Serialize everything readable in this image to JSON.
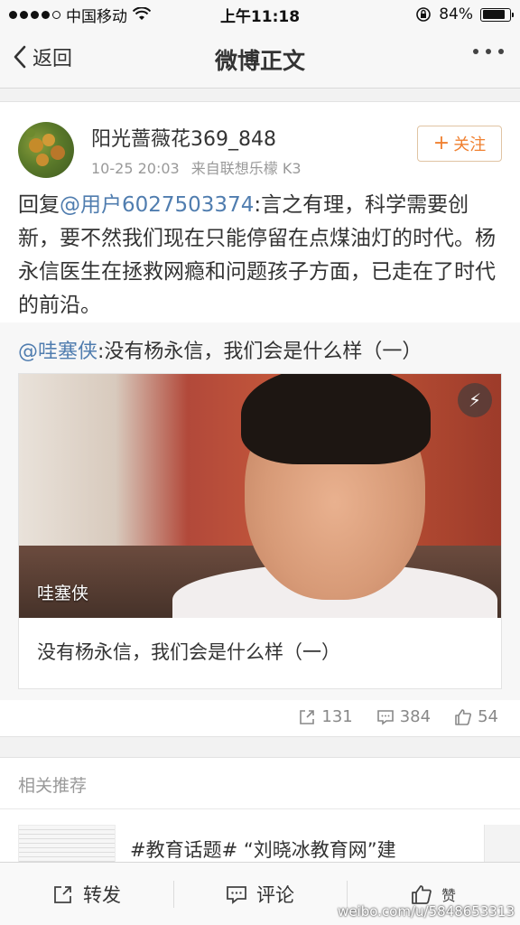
{
  "status_bar": {
    "carrier": "中国移动",
    "time": "上午11:18",
    "battery_percent": "84%",
    "battery_level": 0.84
  },
  "nav": {
    "back_label": "返回",
    "title": "微博正文"
  },
  "post": {
    "username": "阳光蔷薇花369_848",
    "timestamp": "10-25 20:03",
    "source": "来自联想乐檬 K3",
    "follow_label": "关注",
    "reply_prefix": "回复",
    "reply_mention": "@用户6027503374",
    "reply_body": ":言之有理，科学需要创新，要不然我们现在只能停留在点煤油灯的时代。杨永信医生在拯救网瘾和问题孩子方面，已走在了时代的前沿。"
  },
  "quoted": {
    "mention": "@哇塞侠",
    "text": ":没有杨永信，我们会是什么样（一）",
    "video_label": "哇塞侠",
    "caption": "没有杨永信，我们会是什么样（一）"
  },
  "counts": {
    "reposts": "131",
    "comments": "384",
    "likes": "54"
  },
  "related": {
    "header": "相关推荐",
    "item_title": "#教育话题# “刘晓冰教育网”建"
  },
  "toolbar": {
    "repost_label": "转发",
    "comment_label": "评论",
    "like_label": "赞"
  },
  "watermark": "weibo.com/u/5848653313"
}
